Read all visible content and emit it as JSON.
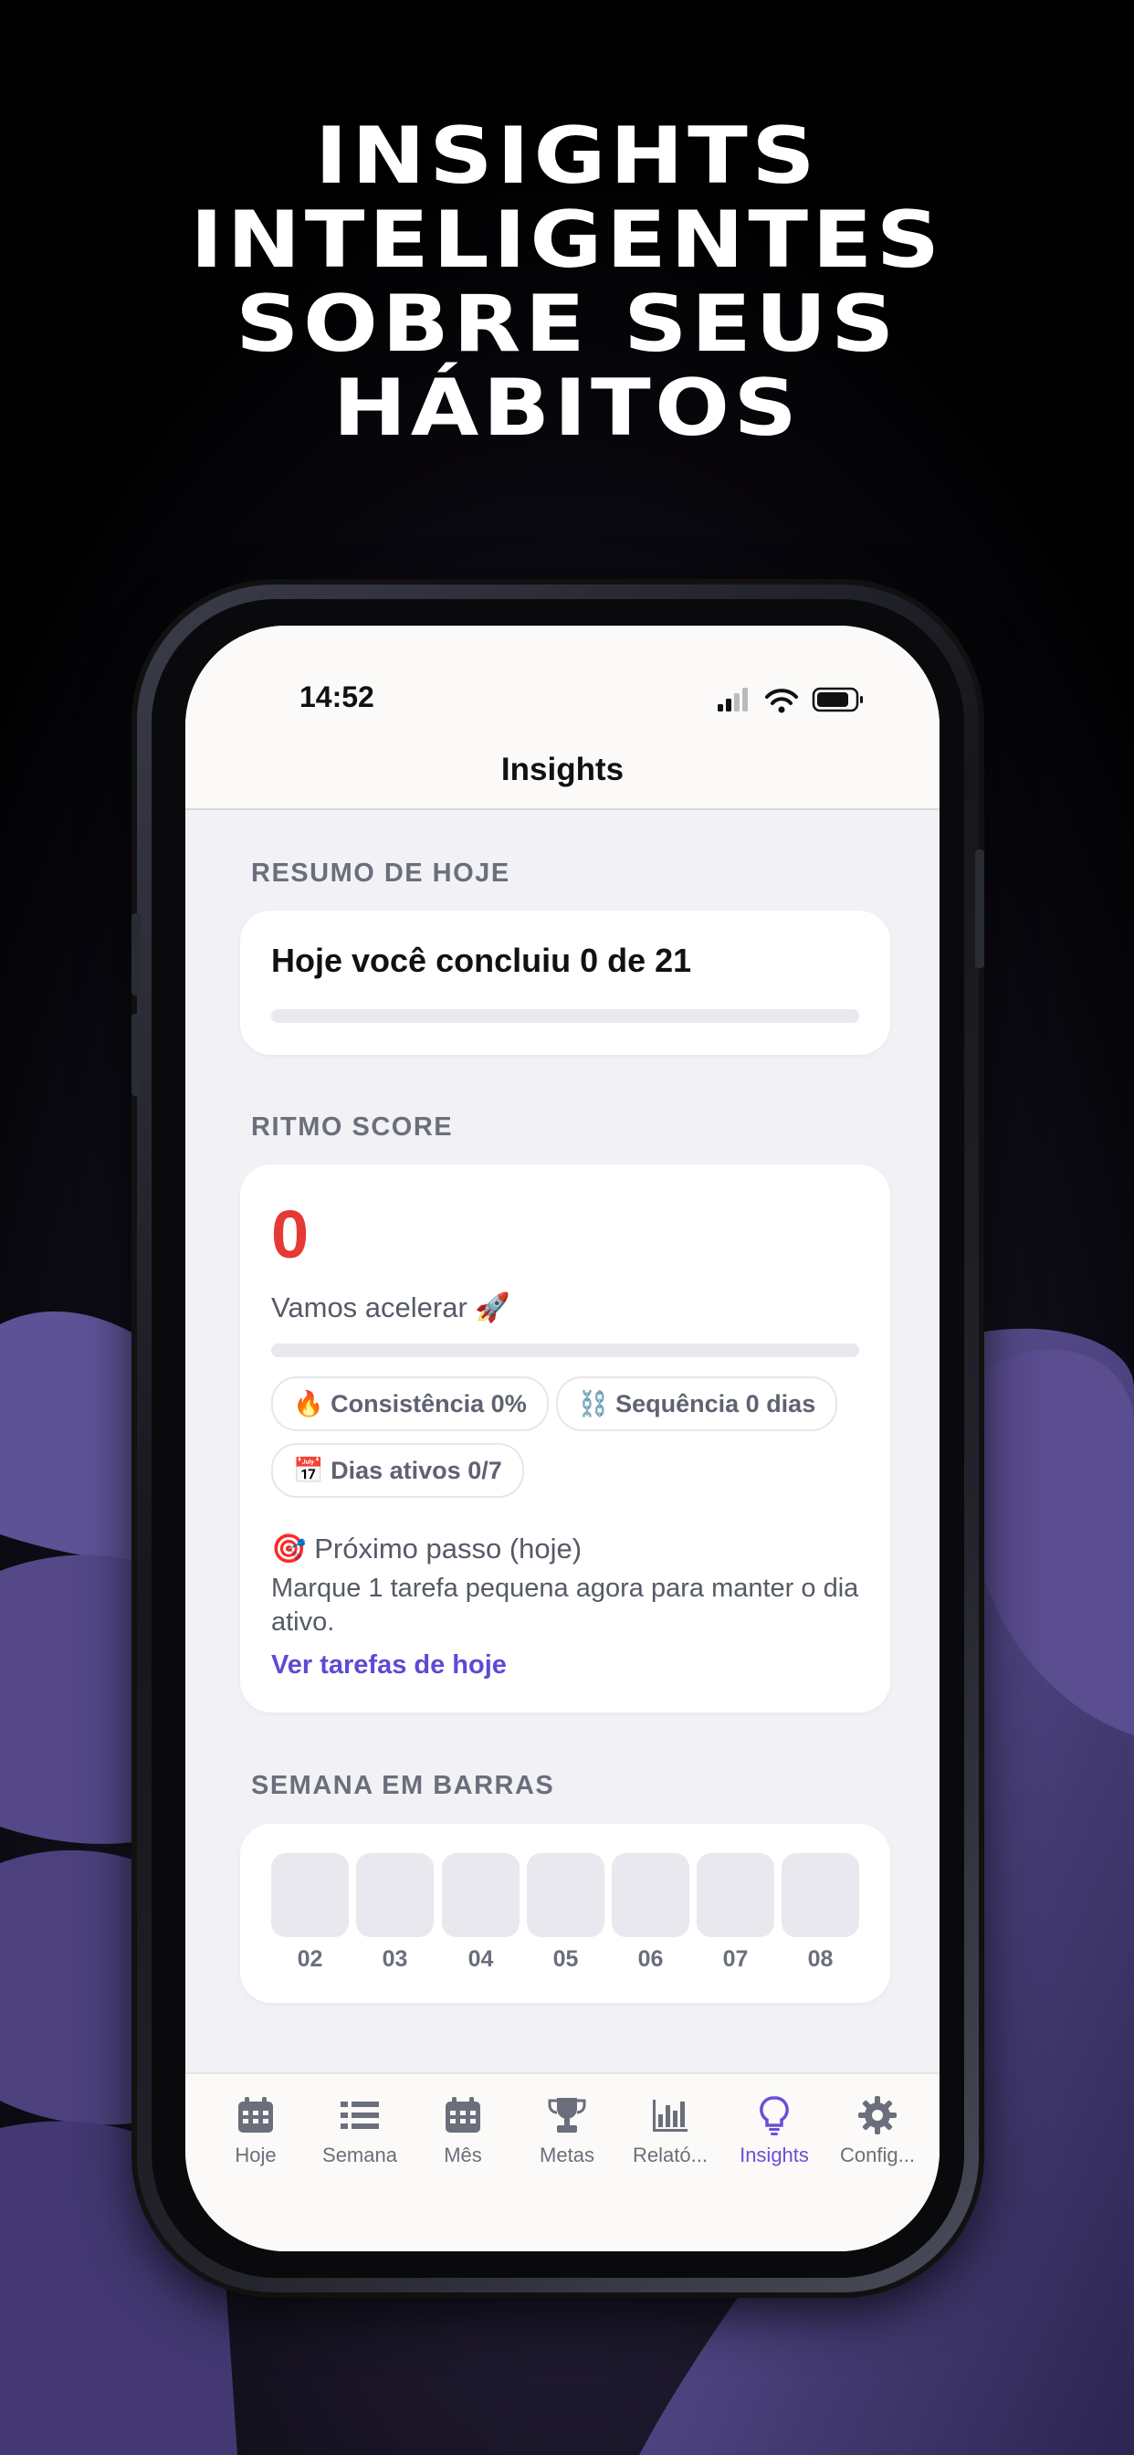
{
  "headline": [
    "INSIGHTS",
    "INTELIGENTES",
    "SOBRE SEUS",
    "HÁBITOS"
  ],
  "status": {
    "time": "14:52"
  },
  "nav": {
    "title": "Insights"
  },
  "summary": {
    "section_label": "RESUMO DE HOJE",
    "text": "Hoje você concluiu 0 de 21",
    "progress": 0
  },
  "ritmo": {
    "section_label": "RITMO SCORE",
    "score": "0",
    "message": "Vamos acelerar 🚀",
    "progress": 0,
    "chips": [
      "🔥 Consistência 0%",
      "⛓️ Sequência 0 dias",
      "📅 Dias ativos 0/7"
    ],
    "next_title": "🎯 Próximo passo (hoje)",
    "next_body": "Marque 1 tarefa pequena agora para manter o dia ativo.",
    "link": "Ver tarefas de hoje"
  },
  "week": {
    "section_label": "SEMANA EM BARRAS",
    "days": [
      "02",
      "03",
      "04",
      "05",
      "06",
      "07",
      "08"
    ]
  },
  "tabs": [
    {
      "label": "Hoje",
      "icon": "calendar-icon"
    },
    {
      "label": "Semana",
      "icon": "list-icon"
    },
    {
      "label": "Mês",
      "icon": "calendar-month-icon"
    },
    {
      "label": "Metas",
      "icon": "trophy-icon"
    },
    {
      "label": "Relató...",
      "icon": "bar-chart-icon"
    },
    {
      "label": "Insights",
      "icon": "lightbulb-icon",
      "active": true
    },
    {
      "label": "Config...",
      "icon": "gear-icon"
    }
  ],
  "colors": {
    "accent": "#6a4fd8",
    "score": "#e53935",
    "background": "#000000"
  }
}
